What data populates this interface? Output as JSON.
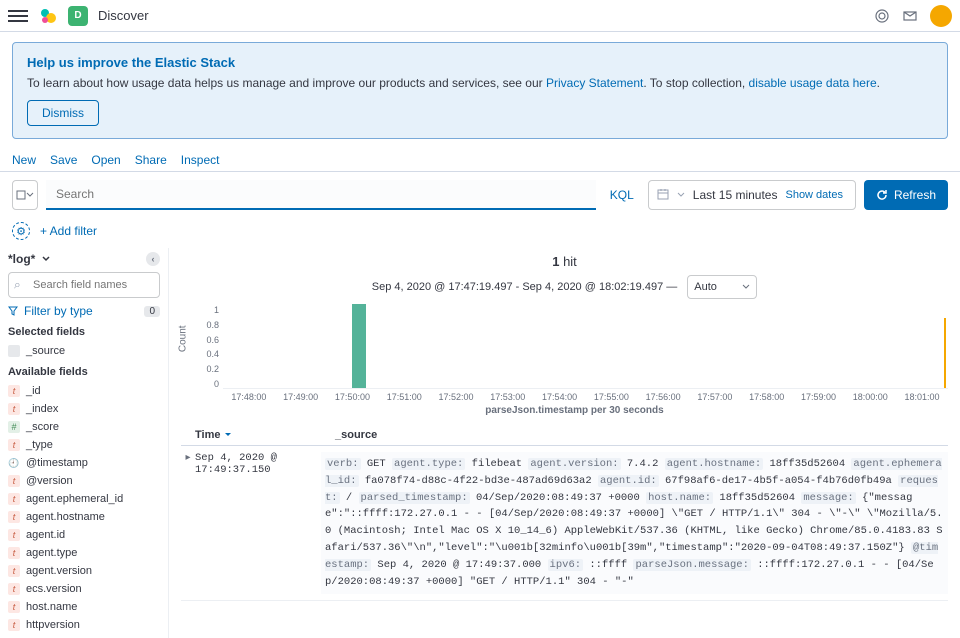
{
  "header": {
    "title": "Discover",
    "badge": "D"
  },
  "banner": {
    "title": "Help us improve the Elastic Stack",
    "text1": "To learn about how usage data helps us manage and improve our products and services, see our ",
    "privacy": "Privacy Statement",
    "text2": ". To stop collection, ",
    "disable": "disable usage data here",
    "text3": ".",
    "dismiss": "Dismiss"
  },
  "toolbar": {
    "new": "New",
    "save": "Save",
    "open": "Open",
    "share": "Share",
    "inspect": "Inspect"
  },
  "search": {
    "placeholder": "Search",
    "kql": "KQL",
    "date": "Last 15 minutes",
    "show_dates": "Show dates",
    "refresh": "Refresh"
  },
  "filter": {
    "add": "+ Add filter"
  },
  "sidebar": {
    "index": "*log*",
    "search_placeholder": "Search field names",
    "filter_type": "Filter by type",
    "filter_count": "0",
    "selected_label": "Selected fields",
    "selected": [
      {
        "type": "blank",
        "name": "_source"
      }
    ],
    "available_label": "Available fields",
    "available": [
      {
        "type": "t",
        "name": "_id"
      },
      {
        "type": "t",
        "name": "_index"
      },
      {
        "type": "hash",
        "name": "_score"
      },
      {
        "type": "t",
        "name": "_type"
      },
      {
        "type": "clock",
        "name": "@timestamp"
      },
      {
        "type": "t",
        "name": "@version"
      },
      {
        "type": "t",
        "name": "agent.ephemeral_id"
      },
      {
        "type": "t",
        "name": "agent.hostname"
      },
      {
        "type": "t",
        "name": "agent.id"
      },
      {
        "type": "t",
        "name": "agent.type"
      },
      {
        "type": "t",
        "name": "agent.version"
      },
      {
        "type": "t",
        "name": "ecs.version"
      },
      {
        "type": "t",
        "name": "host.name"
      },
      {
        "type": "t",
        "name": "httpversion"
      }
    ]
  },
  "hits": {
    "count": "1",
    "label": "hit"
  },
  "timerange": {
    "text": "Sep 4, 2020 @ 17:47:19.497 - Sep 4, 2020 @ 18:02:19.497 —",
    "interval": "Auto"
  },
  "chart_data": {
    "type": "bar",
    "categories": [
      "17:48:00",
      "17:49:00",
      "17:50:00",
      "17:51:00",
      "17:52:00",
      "17:53:00",
      "17:54:00",
      "17:55:00",
      "17:56:00",
      "17:57:00",
      "17:58:00",
      "17:59:00",
      "18:00:00",
      "18:01:00"
    ],
    "series": [
      {
        "name": "Count",
        "values": [
          0,
          0,
          1,
          0,
          0,
          0,
          0,
          0,
          0,
          0,
          0,
          0,
          0,
          0
        ]
      }
    ],
    "ylabel": "Count",
    "xlabel": "parseJson.timestamp per 30 seconds",
    "ylim": [
      0,
      1
    ],
    "yticks": [
      "1",
      "0.8",
      "0.6",
      "0.4",
      "0.2",
      "0"
    ]
  },
  "table": {
    "th_time": "Time",
    "th_source": "_source",
    "row": {
      "time": "Sep 4, 2020 @ 17:49:37.150",
      "kv": [
        {
          "k": "verb:",
          "v": "GET"
        },
        {
          "k": "agent.type:",
          "v": "filebeat"
        },
        {
          "k": "agent.version:",
          "v": "7.4.2"
        },
        {
          "k": "agent.hostname:",
          "v": "18ff35d52604"
        },
        {
          "k": "agent.ephemeral_id:",
          "v": "fa078f74-d88c-4f22-bd3e-487ad69d63a2"
        },
        {
          "k": "agent.id:",
          "v": "67f98af6-de17-4b5f-a054-f4b76d0fb49a"
        },
        {
          "k": "request:",
          "v": "/"
        },
        {
          "k": "parsed_timestamp:",
          "v": "04/Sep/2020:08:49:37 +0000"
        },
        {
          "k": "host.name:",
          "v": "18ff35d52604"
        },
        {
          "k": "message:",
          "v": "{\"message\":\"::ffff:172.27.0.1 - - [04/Sep/2020:08:49:37 +0000] \\\"GET / HTTP/1.1\\\" 304 - \\\"-\\\" \\\"Mozilla/5.0 (Macintosh; Intel Mac OS X 10_14_6) AppleWebKit/537.36 (KHTML, like Gecko) Chrome/85.0.4183.83 Safari/537.36\\\"\\n\",\"level\":\"\\u001b[32minfo\\u001b[39m\",\"timestamp\":\"2020-09-04T08:49:37.150Z\"}"
        },
        {
          "k": "@timestamp:",
          "v": "Sep 4, 2020 @ 17:49:37.000"
        },
        {
          "k": "ipv6:",
          "v": "::ffff"
        },
        {
          "k": "parseJson.message:",
          "v": "::ffff:172.27.0.1 - - [04/Sep/2020:08:49:37 +0000] \"GET / HTTP/1.1\" 304 - \"-\""
        }
      ]
    }
  }
}
